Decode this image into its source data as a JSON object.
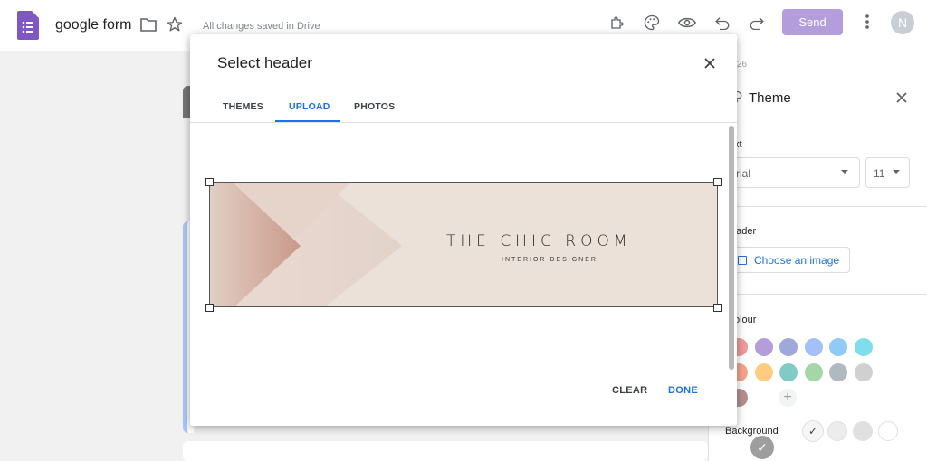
{
  "topbar": {
    "doc_title": "google form",
    "saved_status": "All changes saved in Drive",
    "send_label": "Send",
    "avatar_initial": "N",
    "icons": [
      "forms-app-icon",
      "folder-icon",
      "star-icon",
      "addon-icon",
      "palette-icon",
      "preview-eye-icon",
      "undo-icon",
      "redo-icon",
      "more-vert-icon"
    ]
  },
  "theme_panel": {
    "partial_number": "26",
    "title": "Theme",
    "text_section_label": "xt",
    "font_value": "rial",
    "font_size_value": "11",
    "header_section_label": "eader",
    "choose_image_label": "Choose an image",
    "colour_section_label": "olour",
    "add_color_symbol": "+",
    "selected_check": "✓",
    "background_label": "Background",
    "colors": [
      "#ef9a9a",
      "#b39ddb",
      "#9fa8da",
      "#a3c0f9",
      "#90caf9",
      "#80deea",
      "#f6a28a",
      "#ffcc80",
      "#80cbc4",
      "#a5d6a7",
      "#b0b8c1",
      "#d0d0d0",
      "#b58f8f",
      "#9e9e9e"
    ],
    "background_colors": [
      "#f5f5f5",
      "#ececec",
      "#e0e0e0",
      "#ffffff"
    ]
  },
  "dialog": {
    "title": "Select header",
    "tabs": [
      {
        "label": "THEMES",
        "active": false
      },
      {
        "label": "UPLOAD",
        "active": true
      },
      {
        "label": "PHOTOS",
        "active": false
      }
    ],
    "image": {
      "brand_name": "THE CHIC ROOM",
      "brand_tagline": "INTERIOR DESIGNER"
    },
    "clear_label": "CLEAR",
    "done_label": "DONE"
  },
  "colors": {
    "accent": "#1a73e8",
    "send_button": "#b39ddb",
    "header_background": "#ebe1d8"
  }
}
